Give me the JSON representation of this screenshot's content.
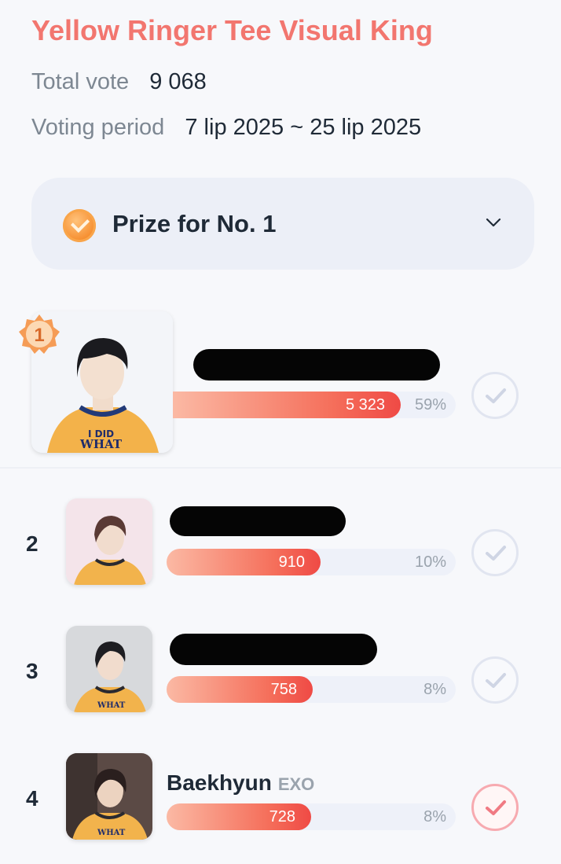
{
  "header": {
    "title": "Yellow Ringer Tee Visual King",
    "total_vote_label": "Total vote",
    "total_vote_value": "9 068",
    "period_label": "Voting period",
    "period_value": "7 lip 2025 ~ 25 lip 2025"
  },
  "prize": {
    "label": "Prize for No. 1",
    "icon": "coin-icon"
  },
  "entries": [
    {
      "rank": "1",
      "name": "",
      "group": "",
      "votes": "5 323",
      "percent": "59%",
      "bar_fraction": 0.59,
      "redacted": true,
      "voted": false
    },
    {
      "rank": "2",
      "name": "",
      "group": "",
      "votes": "910",
      "percent": "10%",
      "bar_fraction": 0.1,
      "redacted": true,
      "voted": false
    },
    {
      "rank": "3",
      "name": "",
      "group": "",
      "votes": "758",
      "percent": "8%",
      "bar_fraction": 0.08,
      "redacted": true,
      "voted": false
    },
    {
      "rank": "4",
      "name": "Baekhyun",
      "group": "EXO",
      "votes": "728",
      "percent": "8%",
      "bar_fraction": 0.08,
      "redacted": false,
      "voted": true
    }
  ],
  "colors": {
    "accent": "#f2766f",
    "bar_end": "#ef4a45",
    "check_inactive": "#e1e5f0",
    "check_active": "#f07a83"
  }
}
